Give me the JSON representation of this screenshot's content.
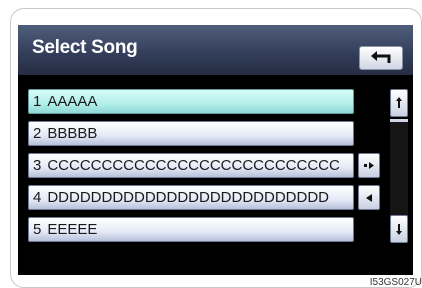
{
  "header": {
    "title": "Select Song",
    "back_icon": "back-arrow-icon"
  },
  "songs": [
    {
      "number": "1",
      "name": "AAAAA",
      "selected": true
    },
    {
      "number": "2",
      "name": "BBBBB",
      "selected": false
    },
    {
      "number": "3",
      "name": "CCCCCCCCCCCCCCCCCCCCCCCCCCC",
      "selected": false
    },
    {
      "number": "4",
      "name": "DDDDDDDDDDDDDDDDDDDDDDDDDD",
      "selected": false
    },
    {
      "number": "5",
      "name": "EEEEE",
      "selected": false
    }
  ],
  "side_buttons": {
    "row3": "scroll-text-right-icon",
    "row4": "scroll-text-left-icon"
  },
  "scrollbar": {
    "up_icon": "page-up-icon",
    "down_icon": "page-down-icon"
  },
  "figure_code": "I53GS027U"
}
